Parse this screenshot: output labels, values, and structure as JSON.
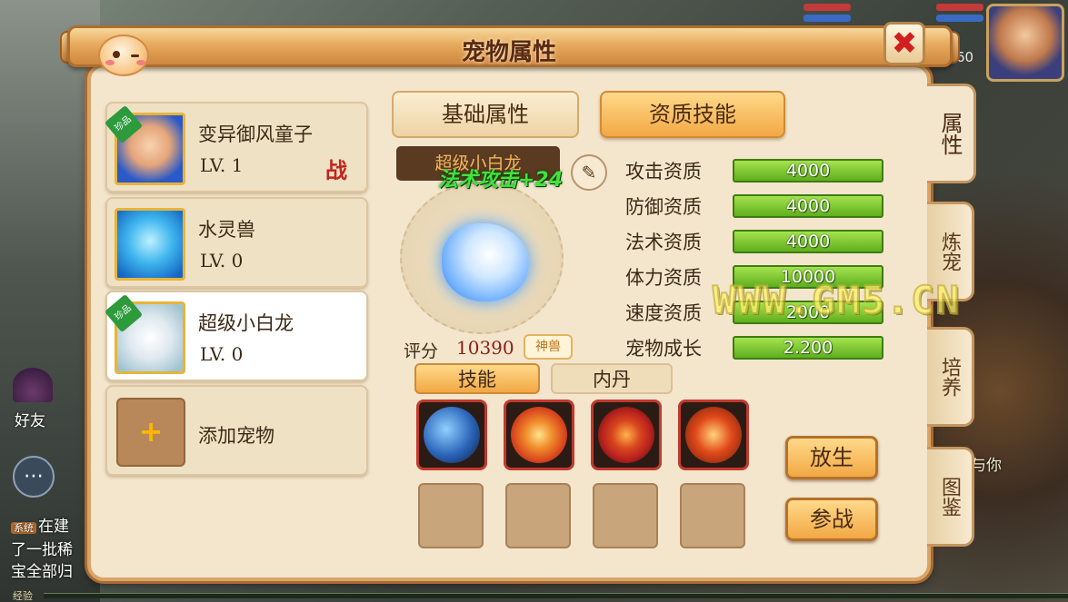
{
  "hud": {
    "level": "60"
  },
  "left_overlay": {
    "friend_label": "好友",
    "chat_icon": "chat-bubble-icon",
    "chat_lines": [
      {
        "tag": "系统",
        "text": "在建"
      },
      {
        "tag": "",
        "text": "了一批稀"
      },
      {
        "tag": "",
        "text": "宝全部归"
      }
    ],
    "exp_label": "经验"
  },
  "right_overlay": {
    "hint_text": "与你"
  },
  "panel": {
    "title": "宠物属性",
    "close_label": "✖"
  },
  "side_tabs": [
    {
      "label": "属性",
      "active": true
    },
    {
      "label": "炼宠",
      "active": false
    },
    {
      "label": "培养",
      "active": false
    },
    {
      "label": "图鉴",
      "active": false
    }
  ],
  "pets": [
    {
      "name": "变异御风童子",
      "level": "LV. 1",
      "badge": "珍品",
      "battle": "战",
      "selected": false
    },
    {
      "name": "水灵兽",
      "level": "LV. 0",
      "badge": "",
      "battle": "",
      "selected": false
    },
    {
      "name": "超级小白龙",
      "level": "LV. 0",
      "badge": "珍品",
      "battle": "",
      "selected": true
    }
  ],
  "add_pet": {
    "icon": "+",
    "label": "添加宠物"
  },
  "top_tabs": {
    "base": "基础属性",
    "skill": "资质技能",
    "active": "skill"
  },
  "detail": {
    "pet_name": "超级小白龙",
    "buff": "法术攻击+24",
    "score_label": "评分",
    "score_value": "10390",
    "rank_badge": "神兽"
  },
  "attributes": [
    {
      "label": "攻击资质",
      "value": "4000"
    },
    {
      "label": "防御资质",
      "value": "4000"
    },
    {
      "label": "法术资质",
      "value": "4000"
    },
    {
      "label": "体力资质",
      "value": "10000"
    },
    {
      "label": "速度资质",
      "value": "2000"
    },
    {
      "label": "宠物成长",
      "value": "2.200"
    }
  ],
  "sub_tabs": {
    "skill": "技能",
    "dan": "内丹",
    "active": "skill"
  },
  "skills": [
    {
      "icon": "blue-beast-skill-icon",
      "color": "#2a63b8"
    },
    {
      "icon": "fire-slash-skill-icon",
      "color": "#d8461e"
    },
    {
      "icon": "demon-ox-skill-icon",
      "color": "#b8231e"
    },
    {
      "icon": "flame-claw-skill-icon",
      "color": "#e24a1a"
    }
  ],
  "empty_slots": 4,
  "actions": {
    "release": "放生",
    "battle": "参战"
  },
  "watermark": "WWW.GM5.CN"
}
